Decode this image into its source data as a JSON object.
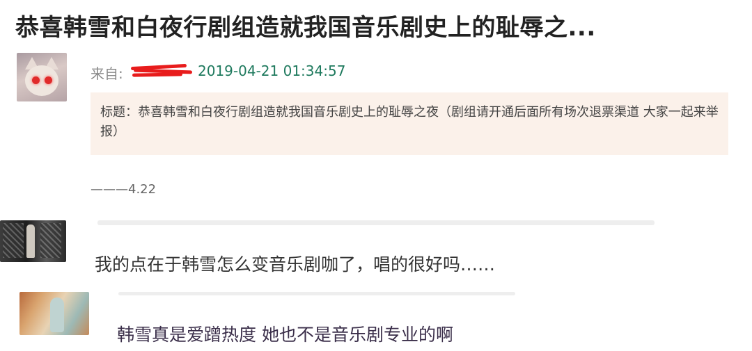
{
  "article": {
    "title": "恭喜韩雪和白夜行剧组造就我国音乐剧史上的耻辱之..."
  },
  "post": {
    "from_label": "来自:",
    "timestamp": "2019-04-21 01:34:57",
    "quote": "标题：恭喜韩雪和白夜行剧组造就我国音乐剧史上的耻辱之夜（剧组请开通后面所有场次退票渠道 大家一起来举报）",
    "signoff": "———4.22"
  },
  "comments": [
    {
      "text": "我的点在于韩雪怎么变音乐剧咖了，唱的很好吗……"
    },
    {
      "text": "韩雪真是爱蹭热度 她也不是音乐剧专业的啊"
    }
  ],
  "colors": {
    "timestamp": "#1f7a5e",
    "redaction": "#e81c1c",
    "quote_background": "#fbf1ea"
  }
}
